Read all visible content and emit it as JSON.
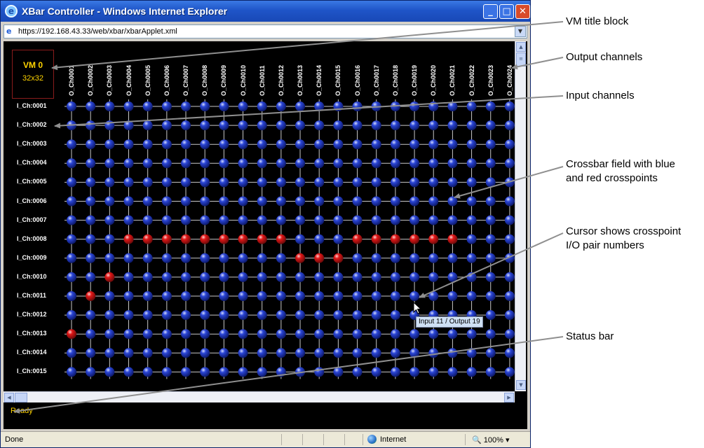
{
  "window": {
    "title": "XBar Controller - Windows Internet Explorer",
    "app_icon": "ie-icon",
    "url": "https://192.168.43.33/web/xbar/xbarApplet.xml",
    "buttons": [
      "minimize-icon",
      "maximize-icon",
      "close-icon"
    ]
  },
  "applet": {
    "vm_title": "VM 0",
    "vm_size": "32x32",
    "output_labels": [
      "O_Ch0001",
      "O_Ch0002",
      "O_Ch0003",
      "O_Ch0004",
      "O_Ch0005",
      "O_Ch0006",
      "O_Ch0007",
      "O_Ch0008",
      "O_Ch0009",
      "O_Ch0010",
      "O_Ch0011",
      "O_Ch0012",
      "O_Ch0013",
      "O_Ch0014",
      "O_Ch0015",
      "O_Ch0016",
      "O_Ch0017",
      "O_Ch0018",
      "O_Ch0019",
      "O_Ch0020",
      "O_Ch0021",
      "O_Ch0022",
      "O_Ch0023",
      "O_Ch0024"
    ],
    "input_labels": [
      "I_Ch:0001",
      "I_Ch:0002",
      "I_Ch:0003",
      "I_Ch:0004",
      "I_Ch:0005",
      "I_Ch:0006",
      "I_Ch:0007",
      "I_Ch:0008",
      "I_Ch:0009",
      "I_Ch:0010",
      "I_Ch:0011",
      "I_Ch:0012",
      "I_Ch:0013",
      "I_Ch:0014",
      "I_Ch:0015"
    ],
    "red_crosspoints": [
      {
        "input": 8,
        "outputs": [
          4,
          5,
          6,
          7,
          8,
          9,
          10,
          11,
          12,
          16,
          17,
          18,
          19,
          20,
          21
        ]
      },
      {
        "input": 9,
        "outputs": [
          13,
          14,
          15
        ]
      },
      {
        "input": 10,
        "outputs": [
          3
        ]
      },
      {
        "input": 11,
        "outputs": [
          2
        ]
      },
      {
        "input": 13,
        "outputs": [
          1
        ]
      }
    ],
    "colors": {
      "blue_crosspoint": "#2a45d6",
      "red_crosspoint": "#e01616",
      "label_yellow": "#ffd400"
    },
    "tooltip": "Input 11 / Output 19",
    "status": "Ready"
  },
  "ie_status": {
    "left": "Done",
    "zone": "Internet",
    "zoom": "100%"
  },
  "annotations": {
    "vm_title_block": "VM title block",
    "output_channels": "Output channels",
    "input_channels": "Input channels",
    "crossbar_line1": "Crossbar field with blue",
    "crossbar_line2": "and red crosspoints",
    "cursor_line1": "Cursor shows crosspoint",
    "cursor_line2": "I/O pair numbers",
    "status_bar": "Status bar"
  }
}
